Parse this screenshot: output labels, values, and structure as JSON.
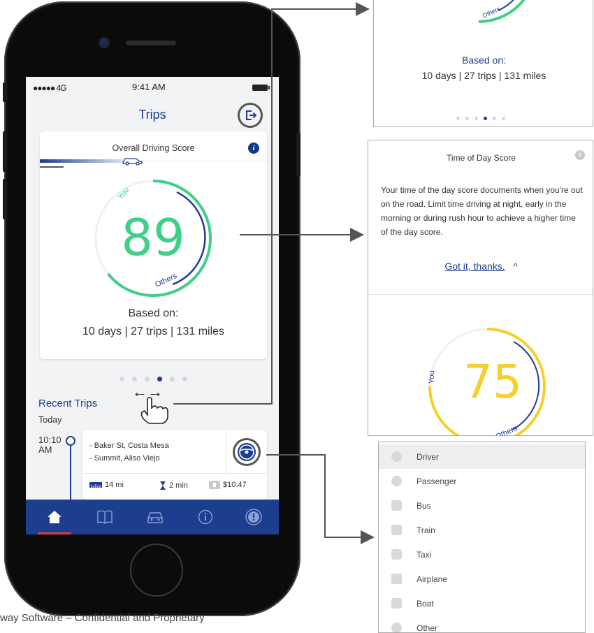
{
  "phone": {
    "status": {
      "signal": "●●●●● 4G",
      "time": "9:41 AM"
    },
    "title": "Trips",
    "score_card": {
      "title": "Overall Driving Score",
      "info_symbol": "i",
      "score": "89",
      "you_label": "You",
      "others_label": "Others",
      "based_label": "Based on:",
      "stats": "10 days | 27 trips | 131 miles"
    },
    "pager": {
      "count": 6,
      "active": 3
    },
    "swipe_hint": "←→",
    "recent": {
      "title": "Recent Trips",
      "day": "Today",
      "trip": {
        "time_line1": "10:10",
        "time_line2": "AM",
        "from": "- Baker St, Costa Mesa",
        "to": "- Summit, Aliso Viejo",
        "distance": "14 mi",
        "duration": "2 min",
        "cost": "$10.47"
      }
    },
    "tabs": [
      "home-icon",
      "book-icon",
      "car-icon",
      "info-icon",
      "profile-icon"
    ]
  },
  "footer_note": "way Software – Confidential and Proprietary",
  "panel_score": {
    "others_label": "Others",
    "based_label": "Based on:",
    "stats": "10 days | 27 trips | 131 miles"
  },
  "panel_time": {
    "title": "Time of Day Score",
    "info_symbol": "i",
    "description": "Your time of the day score documents when you're out on the road. Limit time driving at night, early in the morning or during rush hour to achieve a higher time of the day score.",
    "link": "Got it, thanks.",
    "link_arrow": "^",
    "score": "75",
    "you_label": "You",
    "others_label": "Others"
  },
  "panel_modes": {
    "items": [
      "Driver",
      "Passenger",
      "Bus",
      "Train",
      "Taxi",
      "Airplane",
      "Boat",
      "Other"
    ],
    "selected": "Driver"
  },
  "colors": {
    "brand_blue": "#1d3d8f",
    "green": "#3fcf86",
    "yellow": "#f5cf2a",
    "red_indicator": "#e03c3c"
  }
}
